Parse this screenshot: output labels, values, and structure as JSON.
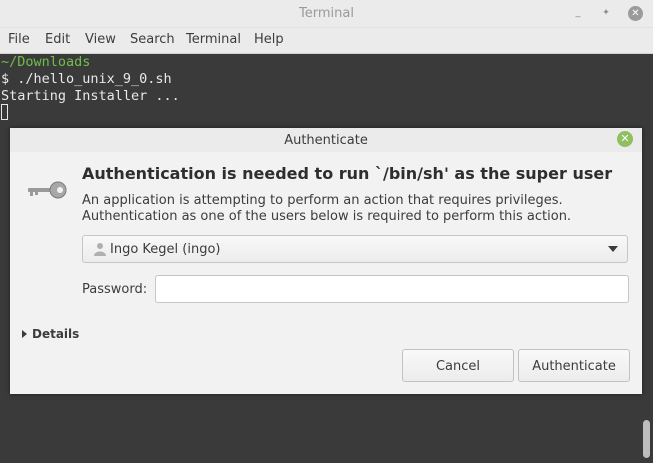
{
  "window": {
    "title": "Terminal",
    "controls": [
      "minimize-icon",
      "maximize-icon",
      "close-icon"
    ]
  },
  "menubar": {
    "items": [
      "File",
      "Edit",
      "View",
      "Search",
      "Terminal",
      "Help"
    ]
  },
  "terminal": {
    "path_line": "~/Downloads",
    "command_line": "$ ./hello_unix_9_0.sh",
    "output_line": "Starting Installer ..."
  },
  "dialog": {
    "title": "Authenticate",
    "icon": "key-icon",
    "heading": "Authentication is needed to run `/bin/sh' as the super user",
    "description": "An application is attempting to perform an action that requires privileges. Authentication as one of the users below is required to perform this action.",
    "user_select": {
      "selected": "Ingo Kegel (ingo)"
    },
    "password_label": "Password:",
    "password_value": "",
    "details_label": "Details",
    "cancel_label": "Cancel",
    "authenticate_label": "Authenticate"
  },
  "colors": {
    "terminal_bg": "#3a3a3a",
    "path_green": "#6fbf4a",
    "close_green": "#8fbf5f"
  }
}
